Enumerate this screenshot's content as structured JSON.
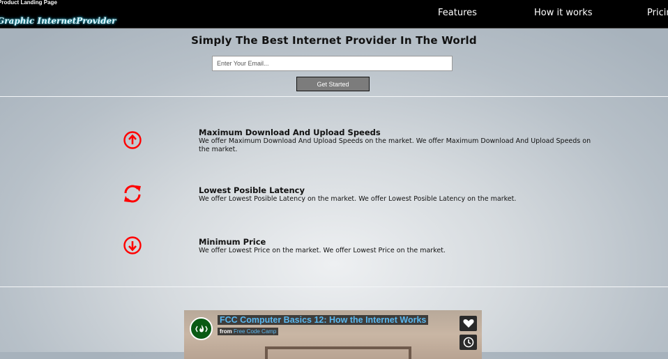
{
  "header": {
    "page_title": "Product Landing Page",
    "logo_text": "Graphic InternetProvider",
    "nav": [
      "Features",
      "How it works",
      "Pricing"
    ]
  },
  "hero": {
    "title": "Simply The Best Internet Provider In The World",
    "email_placeholder": "Enter Your Email...",
    "cta_label": "Get Started"
  },
  "features": [
    {
      "icon": "arrow-up-circle-icon",
      "title": "Maximum Download And Upload Speeds",
      "text": "We offer Maximum Download And Upload Speeds on the market. We offer Maximum Download And Upload Speeds on the market."
    },
    {
      "icon": "sync-icon",
      "title": "Lowest Posible Latency",
      "text": "We offer Lowest Posible Latency on the market. We offer Lowest Posible Latency on the market."
    },
    {
      "icon": "arrow-down-circle-icon",
      "title": "Minimum Price",
      "text": "We offer Lowest Price on the market. We offer Lowest Price on the market."
    }
  ],
  "video": {
    "title": "FCC Computer Basics 12: How the Internet Works",
    "from_label": "from",
    "channel": "Free Code Camp"
  },
  "colors": {
    "accent_red": "#ff0000",
    "topbar": "#000000",
    "video_link": "#5ab8f0"
  }
}
